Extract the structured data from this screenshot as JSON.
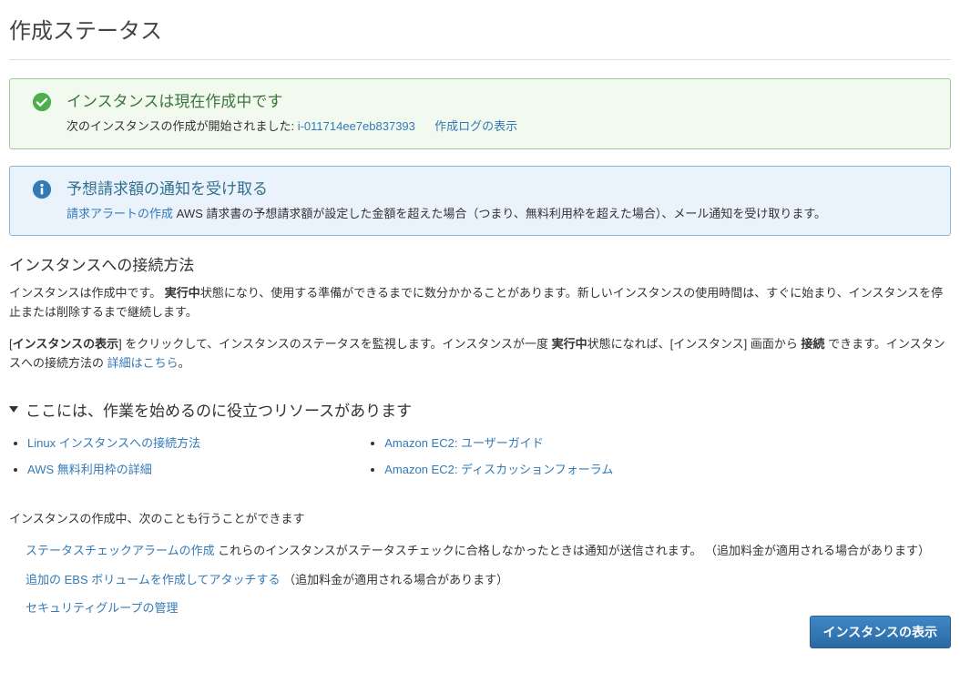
{
  "page_title": "作成ステータス",
  "alerts": {
    "launching": {
      "title": "インスタンスは現在作成中です",
      "prefix": "次のインスタンスの作成が開始されました: ",
      "instance_id": "i-011714ee7eb837393",
      "log_link": "作成ログの表示"
    },
    "billing": {
      "title": "予想請求額の通知を受け取る",
      "link": "請求アラートの作成",
      "text": " AWS 請求書の予想請求額が設定した金額を超えた場合（つまり、無料利用枠を超えた場合）、メール通知を受け取ります。"
    }
  },
  "connect": {
    "heading": "インスタンスへの接続方法",
    "p1a": "インスタンスは作成中です。 ",
    "p1_bold": "実行中",
    "p1b": "状態になり、使用する準備ができるまでに数分かかることがあります。新しいインスタンスの使用時間は、すぐに始まり、インスタンスを停止または削除するまで継続します。",
    "p2a": "[",
    "p2_bold1": "インスタンスの表示",
    "p2b": "] をクリックして、インスタンスのステータスを監視します。インスタンスが一度 ",
    "p2_bold2": "実行中",
    "p2c": "状態になれば、[インスタンス] 画面から ",
    "p2_bold3": "接続",
    "p2d": " できます。インスタンスへの接続方法の ",
    "p2_link": "詳細はこちら",
    "p2e": "。"
  },
  "resources": {
    "heading": "ここには、作業を始めるのに役立つリソースがあります",
    "left": [
      "Linux インスタンスへの接続方法",
      "AWS 無料利用枠の詳細"
    ],
    "right": [
      "Amazon EC2: ユーザーガイド",
      "Amazon EC2: ディスカッションフォーラム"
    ]
  },
  "additional": {
    "intro": "インスタンスの作成中、次のことも行うことができます",
    "items": [
      {
        "link": "ステータスチェックアラームの作成",
        "text": " これらのインスタンスがステータスチェックに合格しなかったときは通知が送信されます。 （追加料金が適用される場合があります）"
      },
      {
        "link": "追加の EBS ボリュームを作成してアタッチする",
        "text": " （追加料金が適用される場合があります）"
      },
      {
        "link": "セキュリティグループの管理",
        "text": ""
      }
    ]
  },
  "footer_button": "インスタンスの表示"
}
